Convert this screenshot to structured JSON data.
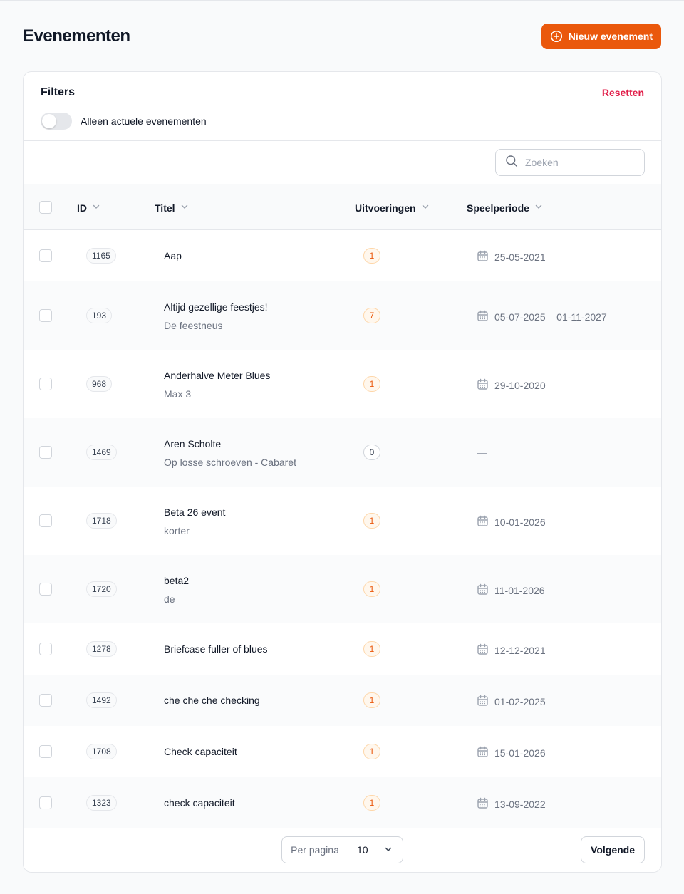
{
  "header": {
    "title": "Evenementen",
    "new_button_label": "Nieuw evenement"
  },
  "filters": {
    "title": "Filters",
    "reset_label": "Resetten",
    "toggle_label": "Alleen actuele evenementen",
    "toggle_on": false
  },
  "search": {
    "placeholder": "Zoeken"
  },
  "table": {
    "columns": {
      "id": "ID",
      "title": "Titel",
      "performances": "Uitvoeringen",
      "period": "Speelperiode"
    },
    "rows": [
      {
        "id": "1165",
        "title": "Aap",
        "subtitle": "",
        "count": "1",
        "period": "25-05-2021"
      },
      {
        "id": "193",
        "title": "Altijd gezellige feestjes!",
        "subtitle": "De feestneus",
        "count": "7",
        "period": "05-07-2025 – 01-11-2027"
      },
      {
        "id": "968",
        "title": "Anderhalve Meter Blues",
        "subtitle": "Max 3",
        "count": "1",
        "period": "29-10-2020"
      },
      {
        "id": "1469",
        "title": "Aren Scholte",
        "subtitle": "Op losse schroeven - Cabaret",
        "count": "0",
        "period": "—"
      },
      {
        "id": "1718",
        "title": "Beta 26 event",
        "subtitle": "korter",
        "count": "1",
        "period": "10-01-2026"
      },
      {
        "id": "1720",
        "title": "beta2",
        "subtitle": "de",
        "count": "1",
        "period": "11-01-2026"
      },
      {
        "id": "1278",
        "title": "Briefcase fuller of blues",
        "subtitle": "",
        "count": "1",
        "period": "12-12-2021"
      },
      {
        "id": "1492",
        "title": "che che che checking",
        "subtitle": "",
        "count": "1",
        "period": "01-02-2025"
      },
      {
        "id": "1708",
        "title": "Check capaciteit",
        "subtitle": "",
        "count": "1",
        "period": "15-01-2026"
      },
      {
        "id": "1323",
        "title": "check capaciteit",
        "subtitle": "",
        "count": "1",
        "period": "13-09-2022"
      }
    ]
  },
  "pagination": {
    "per_page_label": "Per pagina",
    "per_page_value": "10",
    "next_label": "Volgende"
  },
  "colors": {
    "accent": "#ea580c",
    "reset": "#e11d48"
  },
  "icons": [
    "plus-circle-icon",
    "search-icon",
    "chevron-down-icon",
    "calendar-icon"
  ]
}
